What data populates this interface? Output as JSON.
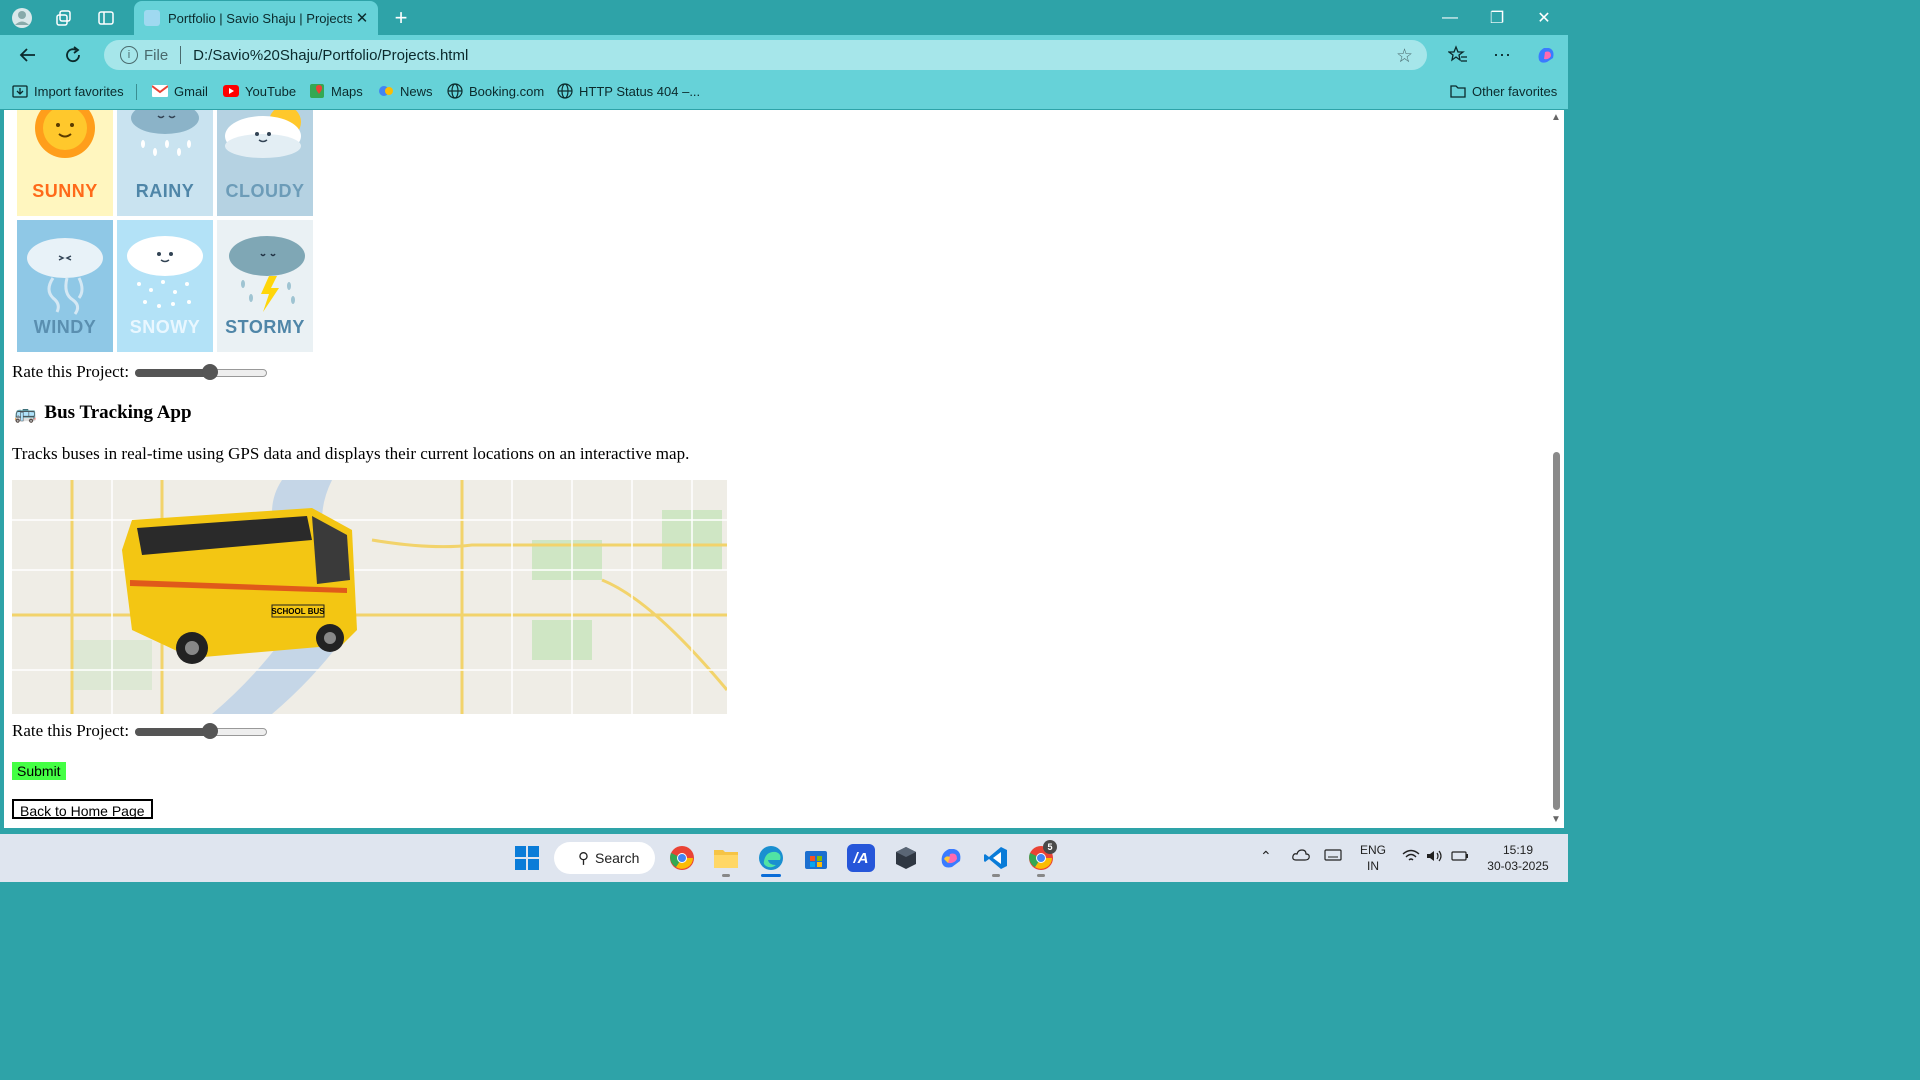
{
  "browser": {
    "tab_title": "Portfolio | Savio Shaju | Projects",
    "tab_close": "✕",
    "new_tab": "+",
    "address_prefix": "File",
    "url": "D:/Savio%20Shaju/Portfolio/Projects.html",
    "window_controls": {
      "minimize": "—",
      "restore": "❐",
      "close": "✕"
    }
  },
  "favorites": {
    "items": [
      {
        "label": "Import favorites",
        "icon": "import-icon"
      },
      {
        "label": "Gmail",
        "icon": "gmail-icon"
      },
      {
        "label": "YouTube",
        "icon": "youtube-icon"
      },
      {
        "label": "Maps",
        "icon": "maps-icon"
      },
      {
        "label": "News",
        "icon": "news-icon"
      },
      {
        "label": "Booking.com",
        "icon": "globe-icon"
      },
      {
        "label": "HTTP Status 404 –...",
        "icon": "globe-icon"
      }
    ],
    "other": "Other favorites"
  },
  "page": {
    "weather_labels": [
      "SUNNY",
      "RAINY",
      "CLOUDY",
      "WINDY",
      "SNOWY",
      "STORMY"
    ],
    "rating_label": "Rate this Project:",
    "rating_value": 0.58,
    "project": {
      "emoji": "🚌",
      "title": "Bus Tracking App",
      "description": "Tracks buses in real-time using GPS data and displays their current locations on an interactive map.",
      "bus_sign": "SCHOOL BUS"
    },
    "rating2_label": "Rate this Project:",
    "rating2_value": 0.58,
    "submit": "Submit",
    "home": "Back to Home Page"
  },
  "taskbar": {
    "search": "Search",
    "lang_top": "ENG",
    "lang_bottom": "IN",
    "time": "15:19",
    "date": "30-03-2025",
    "badge": "5"
  }
}
